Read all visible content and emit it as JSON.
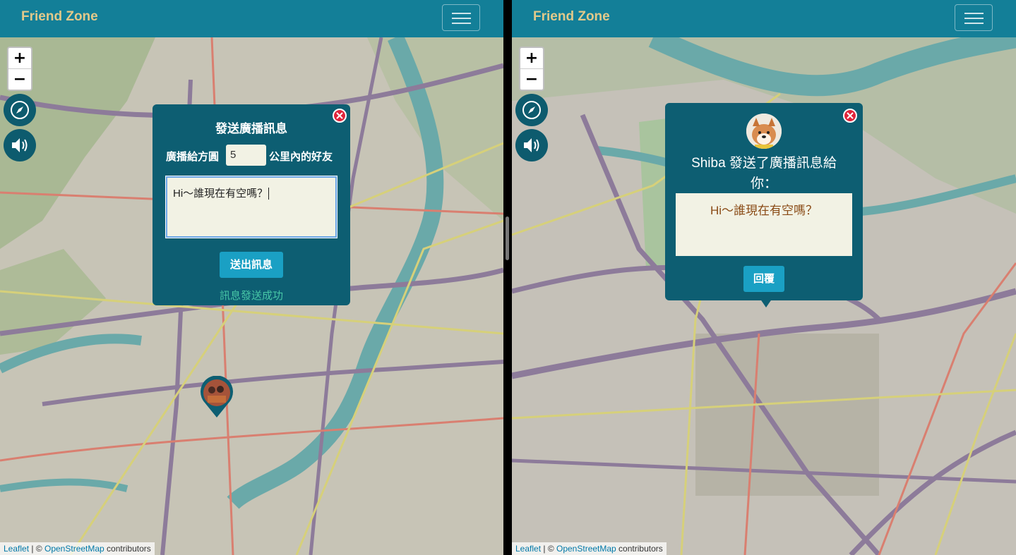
{
  "colors": {
    "navbar": "#137f98",
    "brand": "#e2c98a",
    "popup": "#0d5e72",
    "button": "#1aa0c4",
    "success": "#47c6a6",
    "close": "#e0243a",
    "message_bg": "#f2f2e4",
    "reply_text": "#8a4b16"
  },
  "left": {
    "brand": "Friend Zone",
    "popup": {
      "title": "發送廣播訊息",
      "radius_prefix": "廣播給方圓",
      "radius_value": "5",
      "radius_suffix": "公里內的好友",
      "message": "Hi～誰現在有空嗎？",
      "send_label": "送出訊息",
      "status": "訊息發送成功"
    },
    "attribution": {
      "leaflet": "Leaflet",
      "separator": " | © ",
      "osm": "OpenStreetMap",
      "suffix": " contributors"
    },
    "zoom": {
      "in": "+",
      "out": "−"
    },
    "icons": [
      "compass-icon",
      "speaker-icon",
      "close-icon",
      "menu-icon"
    ]
  },
  "right": {
    "brand": "Friend Zone",
    "popup": {
      "title_line1": "Shiba 發送了廣播訊息給",
      "title_line2": "你：",
      "message": "Hi～誰現在有空嗎？",
      "reply_label": "回覆"
    },
    "attribution": {
      "leaflet": "Leaflet",
      "separator": " | © ",
      "osm": "OpenStreetMap",
      "suffix": " contributors"
    },
    "zoom": {
      "in": "+",
      "out": "−"
    },
    "icons": [
      "compass-icon",
      "speaker-icon",
      "close-icon",
      "menu-icon",
      "avatar-icon"
    ]
  }
}
